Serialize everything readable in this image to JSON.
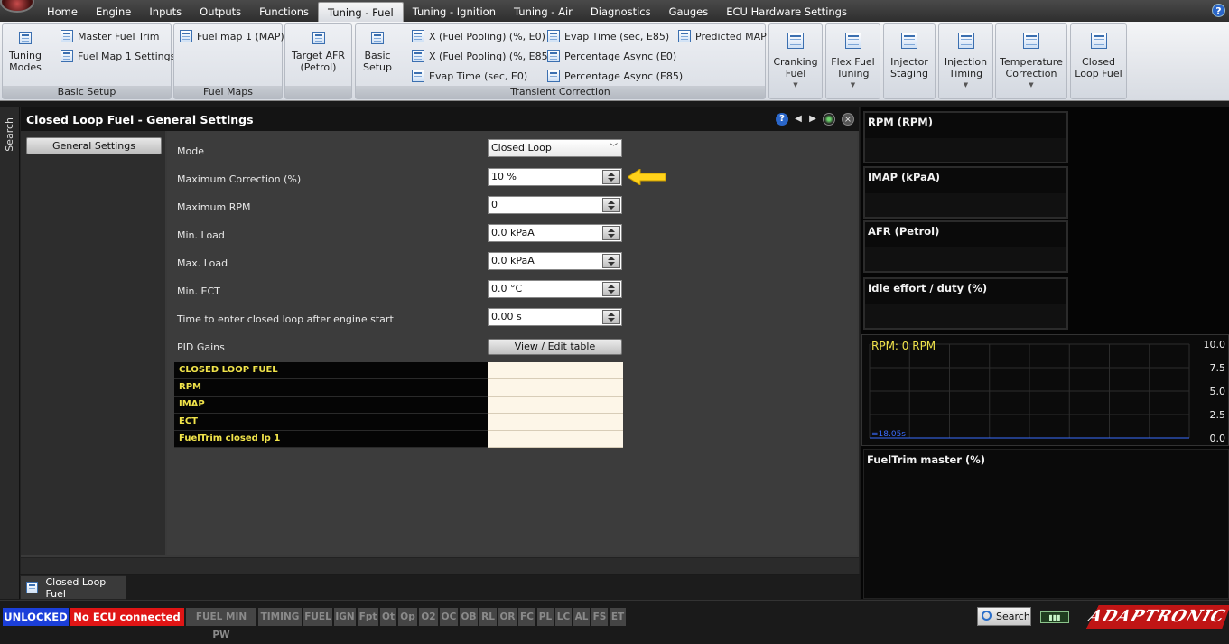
{
  "menu": {
    "tabs": [
      "Home",
      "Engine",
      "Inputs",
      "Outputs",
      "Functions",
      "Tuning - Fuel",
      "Tuning - Ignition",
      "Tuning - Air",
      "Diagnostics",
      "Gauges",
      "ECU Hardware Settings"
    ],
    "active": "Tuning - Fuel",
    "help": "?"
  },
  "ribbon": {
    "basic_setup": {
      "label": "Basic Setup",
      "tuning_modes": "Tuning Modes",
      "master_fuel_trim": "Master Fuel Trim",
      "fuel_map_settings": "Fuel Map 1 Settings"
    },
    "fuel_maps": {
      "label": "Fuel Maps",
      "fuel_map_1": "Fuel map 1 (MAP)"
    },
    "target_afr": "Target AFR (Petrol)",
    "transient": {
      "label": "Transient Correction",
      "basic_setup": "Basic Setup",
      "x_e0": "X (Fuel Pooling) (%, E0)",
      "x_e85": "X (Fuel Pooling) (%, E85)",
      "evap_e0": "Evap Time (sec, E0)",
      "evap_e85": "Evap Time (sec, E85)",
      "pct_async_e0": "Percentage Async (E0)",
      "pct_async_e85": "Percentage Async (E85)",
      "predicted_map": "Predicted MAP"
    },
    "buttons": {
      "cranking_fuel": "Cranking Fuel",
      "flex_fuel": "Flex Fuel Tuning",
      "injector_staging": "Injector Staging",
      "injection_timing": "Injection Timing",
      "temperature_correction": "Temperature Correction",
      "closed_loop_fuel": "Closed Loop Fuel"
    }
  },
  "sidebar": {
    "search": "Search"
  },
  "panel": {
    "title": "Closed Loop Fuel - General Settings",
    "nav_button": "General Settings",
    "fields": {
      "mode": {
        "label": "Mode",
        "value": "Closed Loop"
      },
      "max_correction": {
        "label": "Maximum Correction (%)",
        "value": "10 %"
      },
      "max_rpm": {
        "label": "Maximum RPM",
        "value": "0"
      },
      "min_load": {
        "label": "Min. Load",
        "value": "0.0 kPaA"
      },
      "max_load": {
        "label": "Max. Load",
        "value": "0.0 kPaA"
      },
      "min_ect": {
        "label": "Min. ECT",
        "value": "0.0 °C"
      },
      "time_enter": {
        "label": "Time to enter closed loop after engine start",
        "value": "0.00 s"
      },
      "pid_gains": {
        "label": "PID Gains",
        "button": "View / Edit table"
      }
    },
    "status_rows": [
      "CLOSED LOOP FUEL",
      "RPM",
      "IMAP",
      "ECT",
      "FuelTrim closed lp 1"
    ]
  },
  "doc_tab": "Closed Loop Fuel",
  "gauges": {
    "rpm": "RPM (RPM)",
    "imap": "IMAP  (kPaA)",
    "afr": "AFR (Petrol)",
    "idle": "Idle effort / duty (%)",
    "fueltrim": "FuelTrim master (%)"
  },
  "chart_data": {
    "type": "line",
    "title": "RPM:  0 RPM",
    "y_ticks": [
      "10.0",
      "7.5",
      "5.0",
      "2.5",
      "0.0"
    ],
    "ylim": [
      0,
      10
    ],
    "time_label": "=18.05s",
    "series": [
      {
        "values": [
          0,
          0
        ]
      }
    ],
    "grid": true,
    "colors": {
      "title": "#f0e34a",
      "line": "#3a6cff",
      "grid": "#2c2c2c"
    }
  },
  "statusbar": {
    "unlocked": "UNLOCKED",
    "no_ecu": "No ECU connected",
    "indicators": [
      "FUEL MIN PW",
      "TIMING",
      "FUEL",
      "IGN",
      "Fpt",
      "Ot",
      "Op",
      "O2",
      "OC",
      "OB",
      "RL",
      "OR",
      "FC",
      "PL",
      "LC",
      "AL",
      "FS",
      "ET"
    ],
    "search": "Search",
    "brand": "ADAPTRONIC"
  }
}
